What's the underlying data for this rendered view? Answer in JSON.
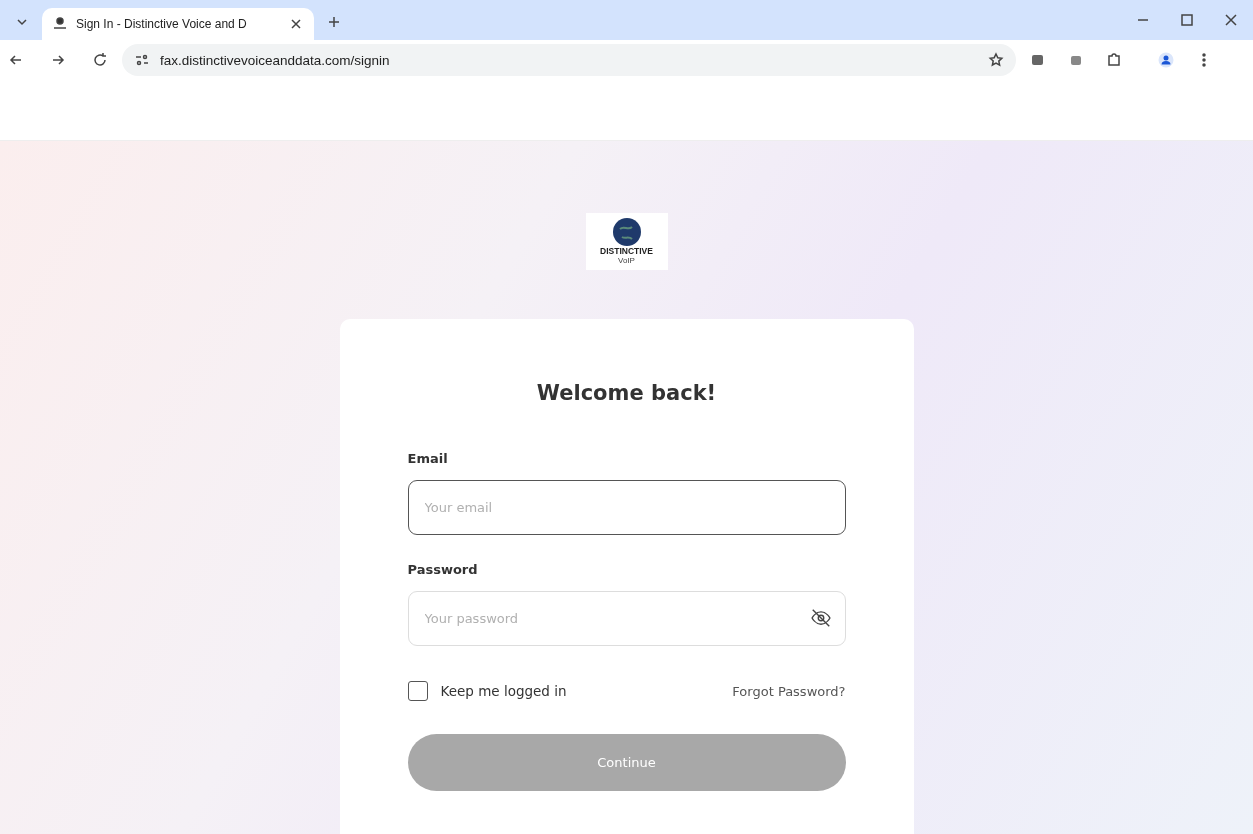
{
  "browser": {
    "tab": {
      "title": "Sign In - Distinctive Voice and D",
      "selected": true
    },
    "url": "fax.distinctivevoiceanddata.com/signin"
  },
  "logo": {
    "name": "DISTINCTIVE",
    "sub": "VoIP"
  },
  "form": {
    "heading": "Welcome back!",
    "fields": [
      {
        "label": "Email",
        "placeholder": "Your email",
        "focused": true,
        "kind": "text"
      },
      {
        "label": "Password",
        "placeholder": "Your password",
        "focused": false,
        "kind": "password"
      }
    ],
    "keep_logged_in": {
      "label": "Keep me logged in",
      "checked": false
    },
    "forgot": "Forgot Password?",
    "submit": {
      "label": "Continue",
      "disabled": true
    }
  }
}
